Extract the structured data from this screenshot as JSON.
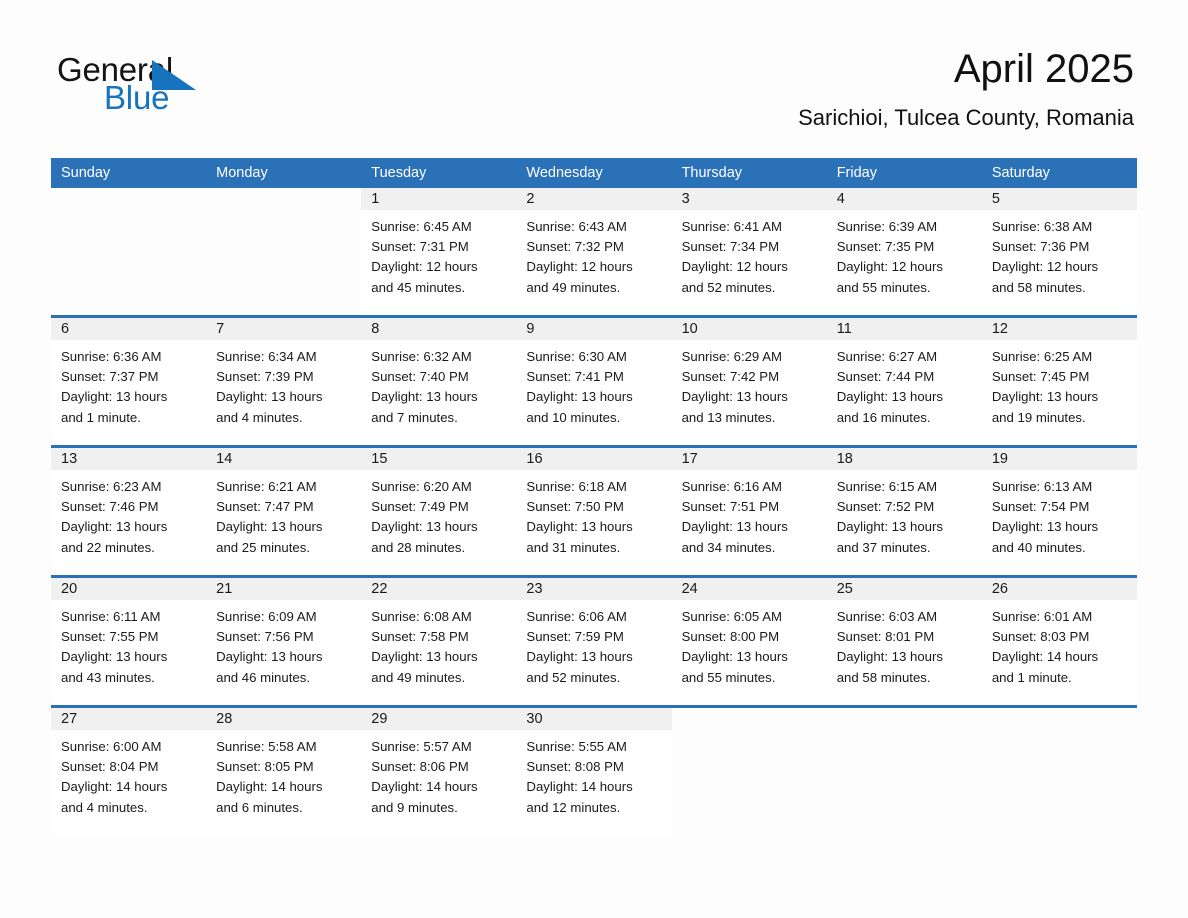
{
  "brand": {
    "name_part1": "General",
    "name_part2": "Blue",
    "accent_color": "#1673be",
    "header_color": "#2b71b8"
  },
  "header": {
    "month_title": "April 2025",
    "location": "Sarichioi, Tulcea County, Romania"
  },
  "calendar": {
    "weekdays": [
      "Sunday",
      "Monday",
      "Tuesday",
      "Wednesday",
      "Thursday",
      "Friday",
      "Saturday"
    ],
    "weeks": [
      [
        {
          "blank": true
        },
        {
          "blank": true
        },
        {
          "date": "1",
          "sunrise": "Sunrise: 6:45 AM",
          "sunset": "Sunset: 7:31 PM",
          "daylight_line1": "Daylight: 12 hours",
          "daylight_line2": "and 45 minutes."
        },
        {
          "date": "2",
          "sunrise": "Sunrise: 6:43 AM",
          "sunset": "Sunset: 7:32 PM",
          "daylight_line1": "Daylight: 12 hours",
          "daylight_line2": "and 49 minutes."
        },
        {
          "date": "3",
          "sunrise": "Sunrise: 6:41 AM",
          "sunset": "Sunset: 7:34 PM",
          "daylight_line1": "Daylight: 12 hours",
          "daylight_line2": "and 52 minutes."
        },
        {
          "date": "4",
          "sunrise": "Sunrise: 6:39 AM",
          "sunset": "Sunset: 7:35 PM",
          "daylight_line1": "Daylight: 12 hours",
          "daylight_line2": "and 55 minutes."
        },
        {
          "date": "5",
          "sunrise": "Sunrise: 6:38 AM",
          "sunset": "Sunset: 7:36 PM",
          "daylight_line1": "Daylight: 12 hours",
          "daylight_line2": "and 58 minutes."
        }
      ],
      [
        {
          "date": "6",
          "sunrise": "Sunrise: 6:36 AM",
          "sunset": "Sunset: 7:37 PM",
          "daylight_line1": "Daylight: 13 hours",
          "daylight_line2": "and 1 minute."
        },
        {
          "date": "7",
          "sunrise": "Sunrise: 6:34 AM",
          "sunset": "Sunset: 7:39 PM",
          "daylight_line1": "Daylight: 13 hours",
          "daylight_line2": "and 4 minutes."
        },
        {
          "date": "8",
          "sunrise": "Sunrise: 6:32 AM",
          "sunset": "Sunset: 7:40 PM",
          "daylight_line1": "Daylight: 13 hours",
          "daylight_line2": "and 7 minutes."
        },
        {
          "date": "9",
          "sunrise": "Sunrise: 6:30 AM",
          "sunset": "Sunset: 7:41 PM",
          "daylight_line1": "Daylight: 13 hours",
          "daylight_line2": "and 10 minutes."
        },
        {
          "date": "10",
          "sunrise": "Sunrise: 6:29 AM",
          "sunset": "Sunset: 7:42 PM",
          "daylight_line1": "Daylight: 13 hours",
          "daylight_line2": "and 13 minutes."
        },
        {
          "date": "11",
          "sunrise": "Sunrise: 6:27 AM",
          "sunset": "Sunset: 7:44 PM",
          "daylight_line1": "Daylight: 13 hours",
          "daylight_line2": "and 16 minutes."
        },
        {
          "date": "12",
          "sunrise": "Sunrise: 6:25 AM",
          "sunset": "Sunset: 7:45 PM",
          "daylight_line1": "Daylight: 13 hours",
          "daylight_line2": "and 19 minutes."
        }
      ],
      [
        {
          "date": "13",
          "sunrise": "Sunrise: 6:23 AM",
          "sunset": "Sunset: 7:46 PM",
          "daylight_line1": "Daylight: 13 hours",
          "daylight_line2": "and 22 minutes."
        },
        {
          "date": "14",
          "sunrise": "Sunrise: 6:21 AM",
          "sunset": "Sunset: 7:47 PM",
          "daylight_line1": "Daylight: 13 hours",
          "daylight_line2": "and 25 minutes."
        },
        {
          "date": "15",
          "sunrise": "Sunrise: 6:20 AM",
          "sunset": "Sunset: 7:49 PM",
          "daylight_line1": "Daylight: 13 hours",
          "daylight_line2": "and 28 minutes."
        },
        {
          "date": "16",
          "sunrise": "Sunrise: 6:18 AM",
          "sunset": "Sunset: 7:50 PM",
          "daylight_line1": "Daylight: 13 hours",
          "daylight_line2": "and 31 minutes."
        },
        {
          "date": "17",
          "sunrise": "Sunrise: 6:16 AM",
          "sunset": "Sunset: 7:51 PM",
          "daylight_line1": "Daylight: 13 hours",
          "daylight_line2": "and 34 minutes."
        },
        {
          "date": "18",
          "sunrise": "Sunrise: 6:15 AM",
          "sunset": "Sunset: 7:52 PM",
          "daylight_line1": "Daylight: 13 hours",
          "daylight_line2": "and 37 minutes."
        },
        {
          "date": "19",
          "sunrise": "Sunrise: 6:13 AM",
          "sunset": "Sunset: 7:54 PM",
          "daylight_line1": "Daylight: 13 hours",
          "daylight_line2": "and 40 minutes."
        }
      ],
      [
        {
          "date": "20",
          "sunrise": "Sunrise: 6:11 AM",
          "sunset": "Sunset: 7:55 PM",
          "daylight_line1": "Daylight: 13 hours",
          "daylight_line2": "and 43 minutes."
        },
        {
          "date": "21",
          "sunrise": "Sunrise: 6:09 AM",
          "sunset": "Sunset: 7:56 PM",
          "daylight_line1": "Daylight: 13 hours",
          "daylight_line2": "and 46 minutes."
        },
        {
          "date": "22",
          "sunrise": "Sunrise: 6:08 AM",
          "sunset": "Sunset: 7:58 PM",
          "daylight_line1": "Daylight: 13 hours",
          "daylight_line2": "and 49 minutes."
        },
        {
          "date": "23",
          "sunrise": "Sunrise: 6:06 AM",
          "sunset": "Sunset: 7:59 PM",
          "daylight_line1": "Daylight: 13 hours",
          "daylight_line2": "and 52 minutes."
        },
        {
          "date": "24",
          "sunrise": "Sunrise: 6:05 AM",
          "sunset": "Sunset: 8:00 PM",
          "daylight_line1": "Daylight: 13 hours",
          "daylight_line2": "and 55 minutes."
        },
        {
          "date": "25",
          "sunrise": "Sunrise: 6:03 AM",
          "sunset": "Sunset: 8:01 PM",
          "daylight_line1": "Daylight: 13 hours",
          "daylight_line2": "and 58 minutes."
        },
        {
          "date": "26",
          "sunrise": "Sunrise: 6:01 AM",
          "sunset": "Sunset: 8:03 PM",
          "daylight_line1": "Daylight: 14 hours",
          "daylight_line2": "and 1 minute."
        }
      ],
      [
        {
          "date": "27",
          "sunrise": "Sunrise: 6:00 AM",
          "sunset": "Sunset: 8:04 PM",
          "daylight_line1": "Daylight: 14 hours",
          "daylight_line2": "and 4 minutes."
        },
        {
          "date": "28",
          "sunrise": "Sunrise: 5:58 AM",
          "sunset": "Sunset: 8:05 PM",
          "daylight_line1": "Daylight: 14 hours",
          "daylight_line2": "and 6 minutes."
        },
        {
          "date": "29",
          "sunrise": "Sunrise: 5:57 AM",
          "sunset": "Sunset: 8:06 PM",
          "daylight_line1": "Daylight: 14 hours",
          "daylight_line2": "and 9 minutes."
        },
        {
          "date": "30",
          "sunrise": "Sunrise: 5:55 AM",
          "sunset": "Sunset: 8:08 PM",
          "daylight_line1": "Daylight: 14 hours",
          "daylight_line2": "and 12 minutes."
        },
        {
          "blank": true
        },
        {
          "blank": true
        },
        {
          "blank": true
        }
      ]
    ]
  }
}
